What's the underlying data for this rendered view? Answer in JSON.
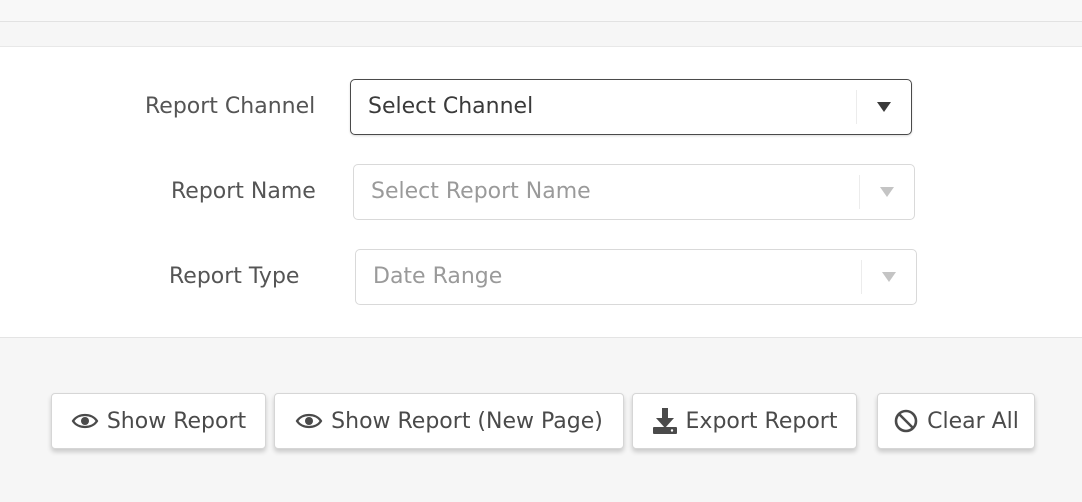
{
  "form": {
    "channel": {
      "label": "Report Channel",
      "value": "Select Channel"
    },
    "name": {
      "label": "Report Name",
      "placeholder": "Select Report Name"
    },
    "type": {
      "label": "Report Type",
      "value": "Date Range"
    }
  },
  "actions": {
    "show_report": "Show Report",
    "show_report_new_page": "Show Report (New Page)",
    "export_report": "Export Report",
    "clear_all": "Clear All"
  },
  "icons": {
    "show_report": "eye-icon",
    "show_report_new_page": "eye-icon",
    "export_report": "download-icon",
    "clear_all": "ban-icon"
  },
  "colors": {
    "text": "#4a4a4a",
    "border": "#d9d9d9",
    "panel": "#ffffff",
    "background": "#f6f6f6"
  }
}
